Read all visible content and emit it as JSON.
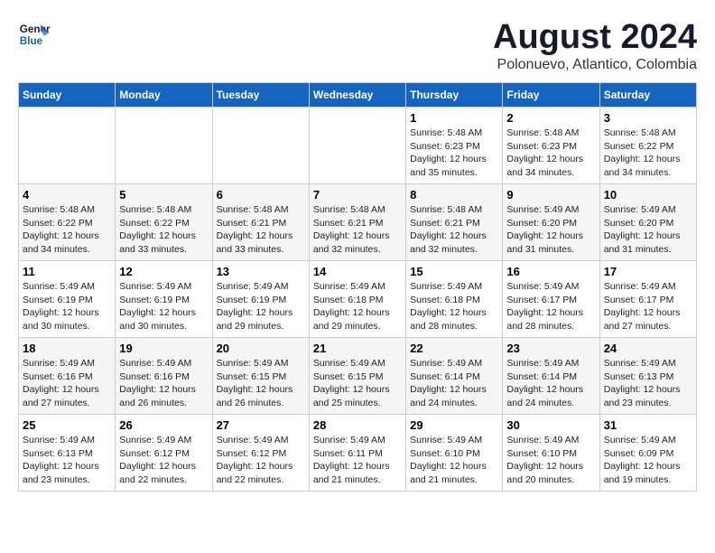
{
  "header": {
    "logo_line1": "General",
    "logo_line2": "Blue",
    "main_title": "August 2024",
    "subtitle": "Polonuevo, Atlantico, Colombia"
  },
  "days_of_week": [
    "Sunday",
    "Monday",
    "Tuesday",
    "Wednesday",
    "Thursday",
    "Friday",
    "Saturday"
  ],
  "weeks": [
    [
      {
        "day": "",
        "info": ""
      },
      {
        "day": "",
        "info": ""
      },
      {
        "day": "",
        "info": ""
      },
      {
        "day": "",
        "info": ""
      },
      {
        "day": "1",
        "info": "Sunrise: 5:48 AM\nSunset: 6:23 PM\nDaylight: 12 hours\nand 35 minutes."
      },
      {
        "day": "2",
        "info": "Sunrise: 5:48 AM\nSunset: 6:23 PM\nDaylight: 12 hours\nand 34 minutes."
      },
      {
        "day": "3",
        "info": "Sunrise: 5:48 AM\nSunset: 6:22 PM\nDaylight: 12 hours\nand 34 minutes."
      }
    ],
    [
      {
        "day": "4",
        "info": "Sunrise: 5:48 AM\nSunset: 6:22 PM\nDaylight: 12 hours\nand 34 minutes."
      },
      {
        "day": "5",
        "info": "Sunrise: 5:48 AM\nSunset: 6:22 PM\nDaylight: 12 hours\nand 33 minutes."
      },
      {
        "day": "6",
        "info": "Sunrise: 5:48 AM\nSunset: 6:21 PM\nDaylight: 12 hours\nand 33 minutes."
      },
      {
        "day": "7",
        "info": "Sunrise: 5:48 AM\nSunset: 6:21 PM\nDaylight: 12 hours\nand 32 minutes."
      },
      {
        "day": "8",
        "info": "Sunrise: 5:48 AM\nSunset: 6:21 PM\nDaylight: 12 hours\nand 32 minutes."
      },
      {
        "day": "9",
        "info": "Sunrise: 5:49 AM\nSunset: 6:20 PM\nDaylight: 12 hours\nand 31 minutes."
      },
      {
        "day": "10",
        "info": "Sunrise: 5:49 AM\nSunset: 6:20 PM\nDaylight: 12 hours\nand 31 minutes."
      }
    ],
    [
      {
        "day": "11",
        "info": "Sunrise: 5:49 AM\nSunset: 6:19 PM\nDaylight: 12 hours\nand 30 minutes."
      },
      {
        "day": "12",
        "info": "Sunrise: 5:49 AM\nSunset: 6:19 PM\nDaylight: 12 hours\nand 30 minutes."
      },
      {
        "day": "13",
        "info": "Sunrise: 5:49 AM\nSunset: 6:19 PM\nDaylight: 12 hours\nand 29 minutes."
      },
      {
        "day": "14",
        "info": "Sunrise: 5:49 AM\nSunset: 6:18 PM\nDaylight: 12 hours\nand 29 minutes."
      },
      {
        "day": "15",
        "info": "Sunrise: 5:49 AM\nSunset: 6:18 PM\nDaylight: 12 hours\nand 28 minutes."
      },
      {
        "day": "16",
        "info": "Sunrise: 5:49 AM\nSunset: 6:17 PM\nDaylight: 12 hours\nand 28 minutes."
      },
      {
        "day": "17",
        "info": "Sunrise: 5:49 AM\nSunset: 6:17 PM\nDaylight: 12 hours\nand 27 minutes."
      }
    ],
    [
      {
        "day": "18",
        "info": "Sunrise: 5:49 AM\nSunset: 6:16 PM\nDaylight: 12 hours\nand 27 minutes."
      },
      {
        "day": "19",
        "info": "Sunrise: 5:49 AM\nSunset: 6:16 PM\nDaylight: 12 hours\nand 26 minutes."
      },
      {
        "day": "20",
        "info": "Sunrise: 5:49 AM\nSunset: 6:15 PM\nDaylight: 12 hours\nand 26 minutes."
      },
      {
        "day": "21",
        "info": "Sunrise: 5:49 AM\nSunset: 6:15 PM\nDaylight: 12 hours\nand 25 minutes."
      },
      {
        "day": "22",
        "info": "Sunrise: 5:49 AM\nSunset: 6:14 PM\nDaylight: 12 hours\nand 24 minutes."
      },
      {
        "day": "23",
        "info": "Sunrise: 5:49 AM\nSunset: 6:14 PM\nDaylight: 12 hours\nand 24 minutes."
      },
      {
        "day": "24",
        "info": "Sunrise: 5:49 AM\nSunset: 6:13 PM\nDaylight: 12 hours\nand 23 minutes."
      }
    ],
    [
      {
        "day": "25",
        "info": "Sunrise: 5:49 AM\nSunset: 6:13 PM\nDaylight: 12 hours\nand 23 minutes."
      },
      {
        "day": "26",
        "info": "Sunrise: 5:49 AM\nSunset: 6:12 PM\nDaylight: 12 hours\nand 22 minutes."
      },
      {
        "day": "27",
        "info": "Sunrise: 5:49 AM\nSunset: 6:12 PM\nDaylight: 12 hours\nand 22 minutes."
      },
      {
        "day": "28",
        "info": "Sunrise: 5:49 AM\nSunset: 6:11 PM\nDaylight: 12 hours\nand 21 minutes."
      },
      {
        "day": "29",
        "info": "Sunrise: 5:49 AM\nSunset: 6:10 PM\nDaylight: 12 hours\nand 21 minutes."
      },
      {
        "day": "30",
        "info": "Sunrise: 5:49 AM\nSunset: 6:10 PM\nDaylight: 12 hours\nand 20 minutes."
      },
      {
        "day": "31",
        "info": "Sunrise: 5:49 AM\nSunset: 6:09 PM\nDaylight: 12 hours\nand 19 minutes."
      }
    ]
  ]
}
